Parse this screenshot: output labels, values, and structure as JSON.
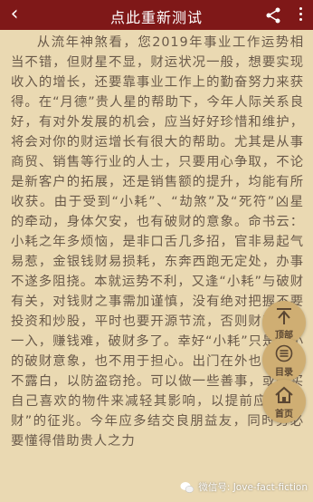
{
  "header": {
    "back_icon": "chevron-left-icon",
    "title": "点此重新测试",
    "share_icon": "share-icon",
    "more_icon": "more-vertical-icon"
  },
  "article": {
    "paragraph": "从流年神煞看，您2019年事业工作运势相当不错，但财星不显，财运状况一般，想要实现收入的增长，还要靠事业工作上的勤奋努力来获得。在“月德”贵人星的帮助下，今年人际关系良好，有对外发展的机会，应当好好珍惜和维护，将会对你的财运增长有很大的帮助。尤其是从事商贸、销售等行业的人士，只要用心争取，不论是新客户的拓展，还是销售额的提升，均能有所收获。由于受到“小耗”、“劫煞”及“死符”凶星的牵动，身体欠安，也有破财的意象。命书云：小耗之年多烦恼，是非口舌几多招，官非易起气易惹，金银钱财易损耗，东奔西跑无定处，办事不遂多阻挠。本就运势不利，又逢“小耗”与破财有关，对钱财之事需加谨慎，没有绝对把握不要投资和炒股，平时也要开源节流，否则财运一出一入，赚钱难，破财多了。幸好“小耗”只是较小的破财意象，也不用于担心。出门在外也谨记财不露白，以防盗窃抢。可以做一些善事，或购买自己喜欢的物件来减轻其影响，以提前应验“破财”的征兆。今年应多结交良朋益友，同时务必要懂得借助贵人之力"
  },
  "floating_buttons": {
    "top": {
      "label": "顶部",
      "icon": "arrow-up-icon"
    },
    "menu": {
      "label": "目录",
      "icon": "list-icon"
    },
    "home": {
      "label": "首页",
      "icon": "home-icon"
    }
  },
  "watermark": {
    "icon": "wechat-icon",
    "text": "微信号: Jove-fact-fiction"
  },
  "colors": {
    "header_bg": "#7f1818",
    "page_bg": "#ead9b2",
    "text": "#6a5a4a",
    "fab_bg": "#cfae73"
  }
}
